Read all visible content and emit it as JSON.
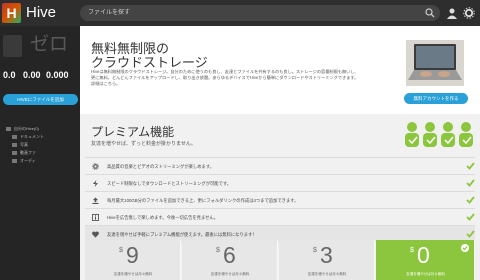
{
  "app": {
    "title": "Hive",
    "logo_letter": "H"
  },
  "search": {
    "placeholder": "ファイルを探す"
  },
  "sidebar": {
    "zero_text": "ゼロ",
    "stats": [
      {
        "value": "0.0",
        "label": ""
      },
      {
        "value": "0.00",
        "label": ""
      },
      {
        "value": "0.000",
        "label": ""
      }
    ],
    "upload_button": "HIVEにファイルを追加",
    "tree": [
      {
        "label": "自分のHive(0)"
      },
      {
        "label": "ドキュメント"
      },
      {
        "label": "写真"
      },
      {
        "label": "動画ファ"
      },
      {
        "label": "オーディ"
      }
    ]
  },
  "hero": {
    "title_line1": "無料無制限の",
    "title_line2": "クラウドストレージ",
    "description": "Hiveは無料無制限のクラウドストレージ。自分のために使うのも良し、友達とファイルを共有するのも良し。ストレージの容量制限も無いし、更に無料。どんどんファイルをアップロードし、取り出き放題。あらゆるデバイスでHiveから簡単にダウンロードやストリーミングできます。詳細はこちら。",
    "free_account_button": "無料アカウントを作る"
  },
  "premium": {
    "title": "プレミアム機能",
    "subtitle": "友達を増やせば、ずっと料金が掛かりません。",
    "features": [
      {
        "text": "高品質の音楽とビデオのストリーミングが楽しめます。",
        "icon": "gear-icon"
      },
      {
        "text": "スピード制限なしでダウンロードとストリーミングが可能です。",
        "icon": "bolt-icon"
      },
      {
        "text": "毎月最大100GB分のファイルを追加できる上、更にフォルダリンクの作成は4つまで追加できます。",
        "icon": "upload-icon"
      },
      {
        "text": "Hiveを広告無しで楽しめます。今後一切広告を見ません。",
        "icon": "info-icon"
      },
      {
        "text": "友達を増やせば手軽にプレミアム機能が使えます。最後には無料になります！",
        "icon": "heart-icon"
      }
    ],
    "prices": [
      {
        "currency": "$",
        "amount": "9",
        "desc": "友達を増やせば月々無料"
      },
      {
        "currency": "$",
        "amount": "6",
        "desc": "友達を増やせば月々無料"
      },
      {
        "currency": "$",
        "amount": "3",
        "desc": "友達を増やせば月々無料"
      },
      {
        "currency": "$",
        "amount": "0",
        "desc": "友達を増やせば月々無料"
      }
    ]
  },
  "colors": {
    "accent_blue": "#29a0d8",
    "accent_green": "#8cc63e",
    "topbar": "#2e2e2e",
    "sidebar": "#252525"
  }
}
